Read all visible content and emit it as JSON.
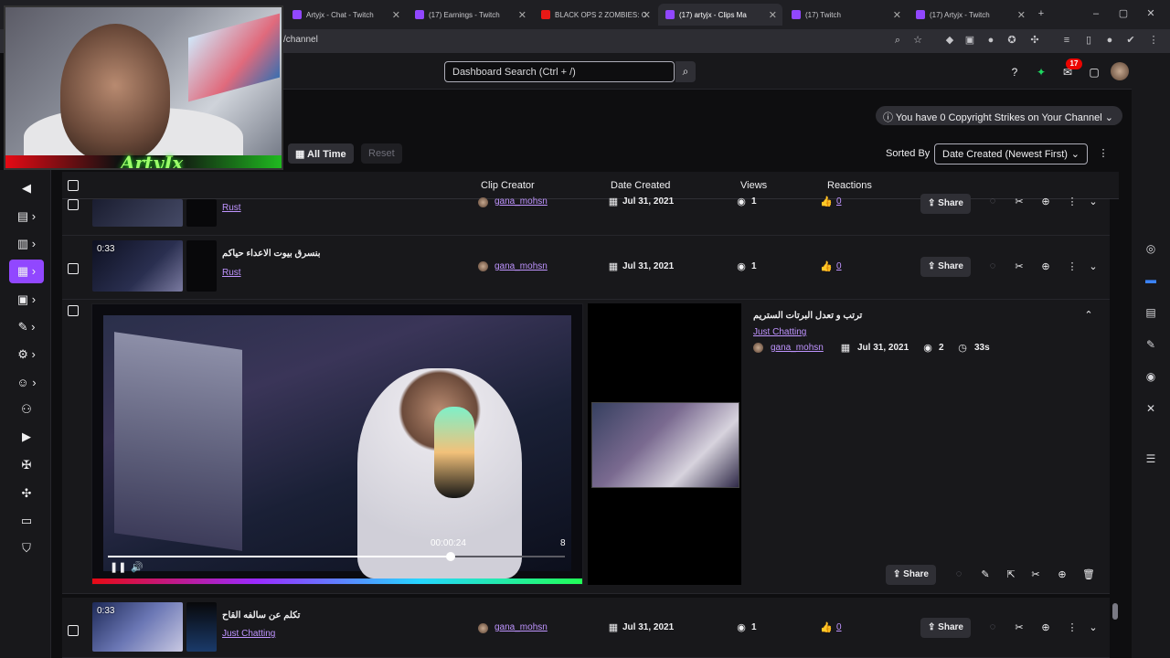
{
  "browser": {
    "tabs": [
      {
        "label": "Artyjx - Chat - Twitch",
        "active": false
      },
      {
        "label": "(17) Earnings - Twitch",
        "active": false
      },
      {
        "label": "BLACK OPS 2 ZOMBIES: C",
        "active": false
      },
      {
        "label": "(17) artyjx - Clips Ma",
        "active": true
      },
      {
        "label": "(17) Twitch",
        "active": false
      },
      {
        "label": "(17) Artyjx - Twitch",
        "active": false
      }
    ],
    "address": "/channel"
  },
  "webcam": {
    "logo_text": "ArtyJx"
  },
  "header": {
    "search_placeholder": "Dashboard Search (Ctrl + /)",
    "notification_count": "17"
  },
  "main": {
    "copyright_text": "You have 0 Copyright Strikes on Your Channel",
    "filter_all_time": "All Time",
    "filter_reset": "Reset",
    "sorted_by_label": "Sorted By",
    "sort_value": "Date Created (Newest First)",
    "columns": {
      "creator": "Clip Creator",
      "date": "Date Created",
      "views": "Views",
      "reactions": "Reactions"
    },
    "rows": [
      {
        "title": "",
        "category": "Rust",
        "creator": "gana_mohsn",
        "date": "Jul 31, 2021",
        "views": "1",
        "reactions": "0",
        "share": "Share"
      },
      {
        "duration": "0:33",
        "title": "بنسرق بيوت الاعداء حياكم",
        "category": "Rust",
        "creator": "gana_mohsn",
        "date": "Jul 31, 2021",
        "views": "1",
        "reactions": "0",
        "share": "Share"
      },
      {
        "duration": "0:33",
        "title": "تكلم عن سالفه القاح",
        "category": "Just Chatting",
        "creator": "gana_mohsn",
        "date": "Jul 31, 2021",
        "views": "1",
        "reactions": "0",
        "share": "Share"
      }
    ],
    "expanded": {
      "title": "ترتب و تعدل البرتات الستريم",
      "category": "Just Chatting",
      "creator": "gana_mohsn",
      "date": "Jul 31, 2021",
      "views": "2",
      "length": "33s",
      "share": "Share",
      "player_time": "00:00:24",
      "player_end": "8",
      "progress": 0.75
    }
  },
  "colors": {
    "accent": "#9147ff",
    "link": "#bf94ff",
    "bg": "#0e0e10"
  }
}
